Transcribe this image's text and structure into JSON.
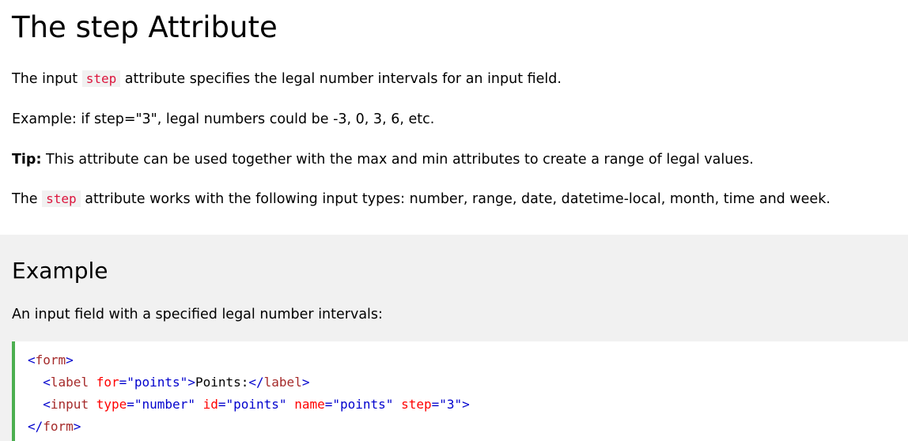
{
  "heading": "The step Attribute",
  "para1": {
    "before": "The input ",
    "code": "step",
    "after": " attribute specifies the legal number intervals for an input field."
  },
  "para2": "Example: if step=\"3\", legal numbers could be -3, 0, 3, 6, etc.",
  "para3": {
    "label": "Tip:",
    "text": " This attribute can be used together with the max and min attributes to create a range of legal values."
  },
  "para4": {
    "before": "The ",
    "code": "step",
    "after": " attribute works with the following input types: number, range, date, datetime-local, month, time and week."
  },
  "example": {
    "title": "Example",
    "description": "An input field with a specified legal number intervals:",
    "code": {
      "line1": {
        "open": "<",
        "tag": "form",
        "close": ">"
      },
      "line2": {
        "indent": "  ",
        "open": "<",
        "tag": "label",
        "attr1": " for",
        "eq1": "=",
        "val1": "\"points\"",
        "close": ">",
        "text": "Points:",
        "end_open": "</",
        "end_tag": "label",
        "end_close": ">"
      },
      "line3": {
        "indent": "  ",
        "open": "<",
        "tag": "input",
        "attr1": " type",
        "eq1": "=",
        "val1": "\"number\"",
        "attr2": " id",
        "eq2": "=",
        "val2": "\"points\"",
        "attr3": " name",
        "eq3": "=",
        "val3": "\"points\"",
        "attr4": " step",
        "eq4": "=",
        "val4": "\"3\"",
        "close": ">"
      },
      "line4": {
        "open": "</",
        "tag": "form",
        "close": ">"
      }
    }
  },
  "colors": {
    "inline_code": "#dc143c",
    "example_bg": "#f1f1f1",
    "code_border": "#4caf50",
    "tag_name": "#a52a2a",
    "attr_name": "#ff0000",
    "attr_value": "#0000cd"
  }
}
